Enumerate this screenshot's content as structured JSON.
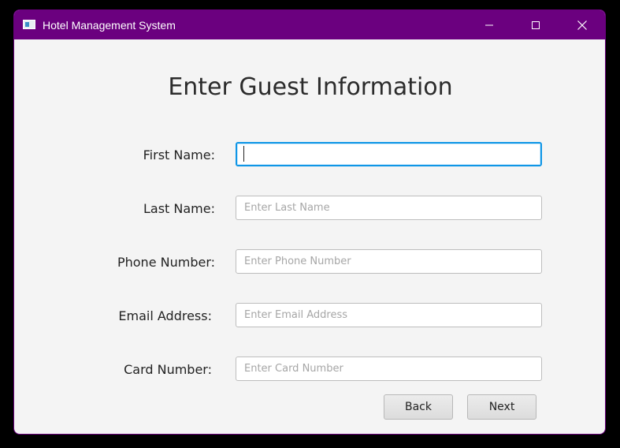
{
  "window": {
    "title": "Hotel Management System",
    "title_bar_color": "#6b007f",
    "icons": {
      "app": "app-window-icon",
      "minimize": "minimize-icon",
      "maximize": "maximize-icon",
      "close": "close-icon"
    }
  },
  "form": {
    "heading": "Enter Guest Information",
    "fields": [
      {
        "label": "First Name:",
        "value": "",
        "placeholder": "",
        "focused": true
      },
      {
        "label": "Last Name:",
        "value": "",
        "placeholder": "Enter Last Name",
        "focused": false
      },
      {
        "label": "Phone Number:",
        "value": "",
        "placeholder": "Enter Phone Number",
        "focused": false
      },
      {
        "label": "Email Address:",
        "value": "",
        "placeholder": "Enter Email Address",
        "focused": false
      },
      {
        "label": "Card Number:",
        "value": "",
        "placeholder": "Enter Card Number",
        "focused": false
      }
    ],
    "focus_color": "#0f96e6"
  },
  "buttons": {
    "back_label": "Back",
    "next_label": "Next"
  }
}
